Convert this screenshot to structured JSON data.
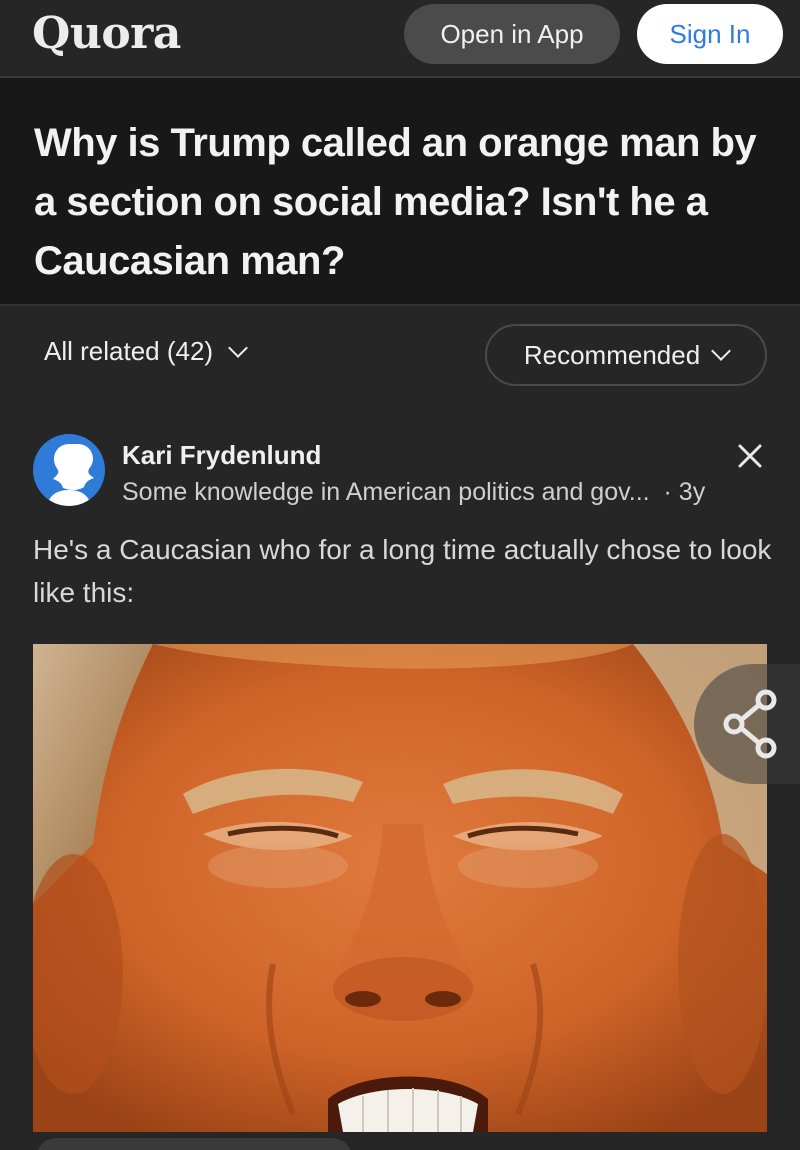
{
  "header": {
    "logo": "Quora",
    "open_in_app": "Open in App",
    "sign_in": "Sign In"
  },
  "question": {
    "title": "Why is Trump called an orange man by a section on social media? Isn't he a Caucasian man?"
  },
  "filters": {
    "all_related": "All related (42)",
    "sort": "Recommended"
  },
  "answer": {
    "author": "Kari Frydenlund",
    "credential": "Some knowledge in American politics and gov...",
    "age": "· 3y",
    "text": "He's a Caucasian who for a long time actually chose to look like this:"
  },
  "colors": {
    "background": "#181818",
    "surface": "#262626",
    "sign_in_text": "#2f7be5",
    "avatar": "#2e7bd8"
  },
  "icons": [
    "chevron-down-icon",
    "close-icon",
    "share-icon",
    "avatar-silhouette-icon"
  ]
}
